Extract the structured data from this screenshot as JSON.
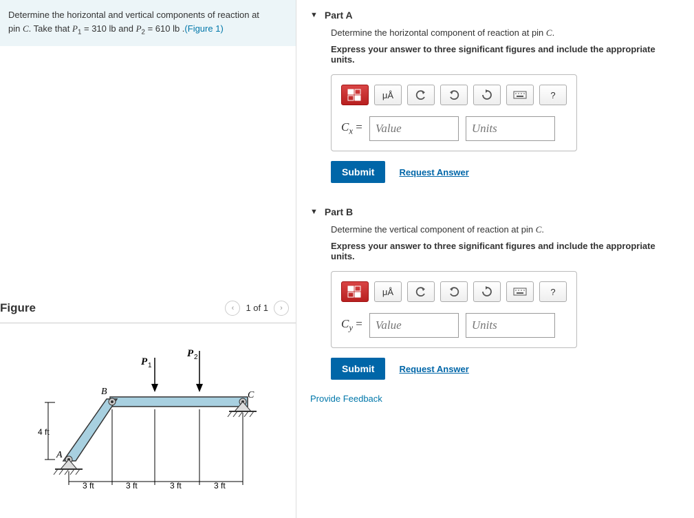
{
  "prompt": {
    "line1_a": "Determine the horizontal and vertical components of reaction at",
    "line2_a": "pin ",
    "c": "C",
    "line2_b": ". Take that ",
    "p1": "P",
    "p1_sub": "1",
    "eq1": " = 310 lb",
    "and": " and ",
    "p2": "P",
    "p2_sub": "2",
    "eq2": " = 610 lb .",
    "figlink": "(Figure 1)"
  },
  "figure": {
    "title": "Figure",
    "counter": "1 of 1",
    "labels": {
      "p1": "P",
      "p1_sub": "1",
      "p2": "P",
      "p2_sub": "2",
      "a": "A",
      "b": "B",
      "c": "C",
      "h": "4 ft",
      "d1": "3 ft",
      "d2": "3 ft",
      "d3": "3 ft",
      "d4": "3 ft"
    }
  },
  "partA": {
    "title": "Part A",
    "instruction_a": "Determine the horizontal component of reaction at pin ",
    "instruction_c": "C",
    "instruction_b": ".",
    "bold": "Express your answer to three significant figures and include the appropriate units.",
    "var_a": "C",
    "var_sub": "x",
    "var_b": " = ",
    "value_ph": "Value",
    "units_ph": "Units",
    "submit": "Submit",
    "request": "Request Answer",
    "mu": "μÅ",
    "q": "?"
  },
  "partB": {
    "title": "Part B",
    "instruction_a": "Determine the vertical component of reaction at pin ",
    "instruction_c": "C",
    "instruction_b": ".",
    "bold": "Express your answer to three significant figures and include the appropriate units.",
    "var_a": "C",
    "var_sub": "y",
    "var_b": " = ",
    "value_ph": "Value",
    "units_ph": "Units",
    "submit": "Submit",
    "request": "Request Answer",
    "mu": "μÅ",
    "q": "?"
  },
  "feedback": "Provide Feedback"
}
